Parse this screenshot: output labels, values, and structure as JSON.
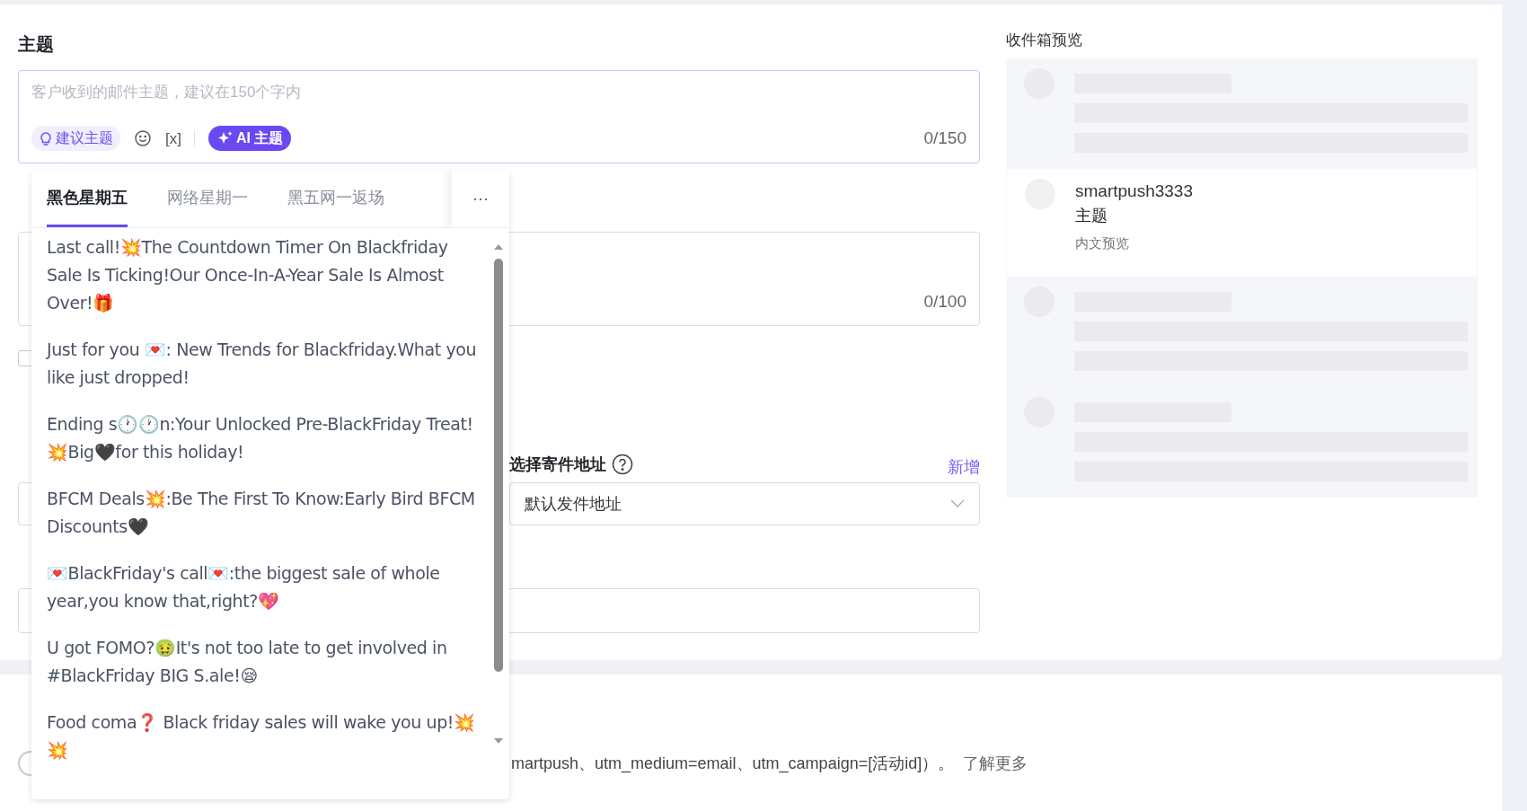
{
  "subject": {
    "label": "主题",
    "placeholder": "客户收到的邮件主题，建议在150个字内",
    "suggest_button": "建议主题",
    "variable_button": "[x]",
    "ai_button": "AI 主题",
    "counter": "0/150"
  },
  "content": {
    "counter": "0/100"
  },
  "checkbox": {
    "checked": false
  },
  "address": {
    "label": "选择寄件地址",
    "add_link": "新增",
    "value": "默认发件地址"
  },
  "advanced": {
    "toggle_on": false,
    "note": "martpush、utm_medium=email、utm_campaign=[活动id]）。",
    "learn_more": "了解更多"
  },
  "popover": {
    "tabs": [
      {
        "label": "黑色星期五",
        "selected": true
      },
      {
        "label": "网络星期一",
        "selected": false
      },
      {
        "label": "黑五网一返场",
        "selected": false
      }
    ],
    "more": "···",
    "items": [
      "Last call!💥The Countdown Timer On Blackfriday Sale Is Ticking!Our Once-In-A-Year Sale Is Almost Over!🎁",
      "Just for you 💌:  New Trends for Blackfriday.What you like just dropped!",
      "Ending s🕐🕐n:Your Unlocked Pre-BlackFriday Treat!💥Big🖤for this holiday!",
      "BFCM Deals💥:Be The First To Know:Early Bird BFCM Discounts🖤",
      "💌BlackFriday's call💌:the biggest sale of whole year,you know that,right?💖",
      "U got FOMO?🤢It's not too late to get involved in #BlackFriday BIG S.ale!😪",
      "Food coma❓ Black friday sales will wake you up!💥💥"
    ]
  },
  "inbox_preview": {
    "title": "收件箱预览",
    "rows": [
      {
        "kind": "skeleton"
      },
      {
        "kind": "message",
        "sender": "smartpush3333",
        "subject": "主题",
        "preview": "内文预览"
      },
      {
        "kind": "skeleton"
      },
      {
        "kind": "skeleton"
      }
    ]
  }
}
